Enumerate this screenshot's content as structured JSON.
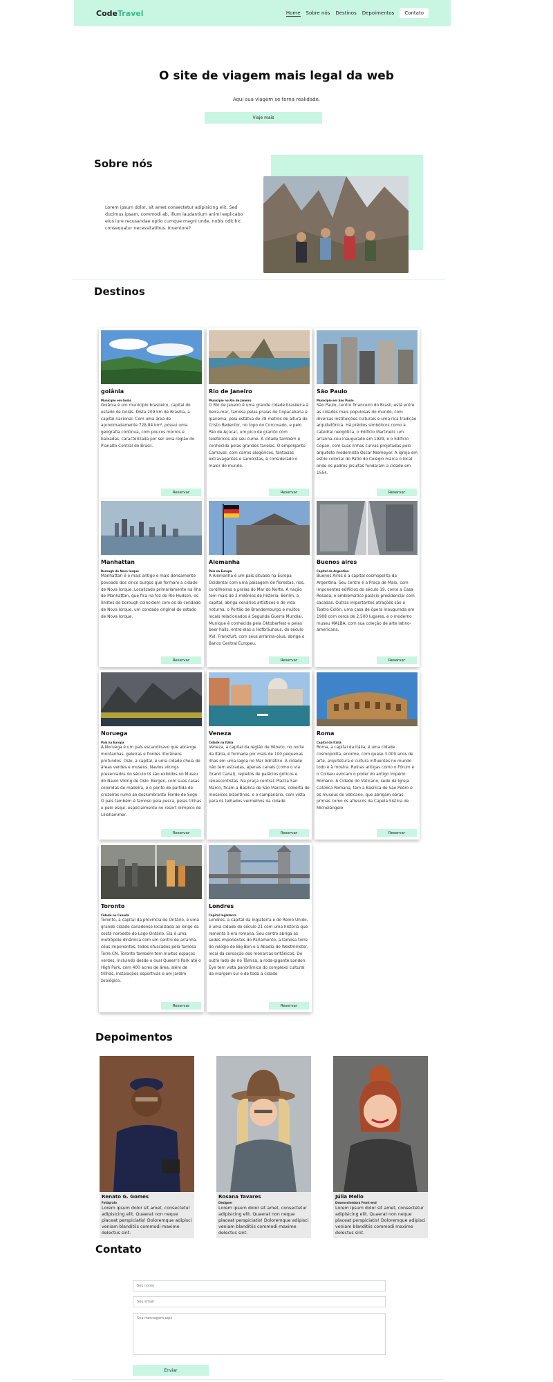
{
  "nav": {
    "logo_main": "Code",
    "logo_accent": "Travel",
    "links": [
      "Home",
      "Sobre nós",
      "Destinos",
      "Depoimentos"
    ],
    "cta": "Contato"
  },
  "hero": {
    "title": "O site de viagem mais legal da web",
    "subtitle": "Aqui sua viagem se torna realidade.",
    "button": "Viaje mais"
  },
  "about": {
    "title": "Sobre nós",
    "text": "Lorem ipsum dolor, sit amet consectetur adipisicing elit. Sed ducimus ipsam, commodi ab, illum laudantium animi explicabo eius iure recusandae optio cumque magni unde, nobis odit hic consequatur necessitatibus. Inventore?"
  },
  "destinations": {
    "title": "Destinos",
    "button_label": "Reservar",
    "cards": [
      {
        "title": "goiânia",
        "subtitle": "Município em Goiás",
        "text": "Goiânia é um município brasileiro, capital do estado de Goiás. Dista 209 km de Brasília, a capital nacional. Com uma área de aproximadamente 728,84 km², possui uma geografia contínua, com poucos morros e baixadas, caracterizada por ser uma região do Planalto Central do Brasil."
      },
      {
        "title": "Rio de Janeiro",
        "subtitle": "Município no Rio de Janeiro",
        "text": "O Rio de Janeiro é uma grande cidade brasileira à beira-mar, famosa pelas praias de Copacabana e Ipanema, pela estátua de 38 metros de altura do Cristo Redentor, no topo do Corcovado, e pelo Pão de Açúcar, um pico de granito com teleféricos até seu cume. A cidade também é conhecida pelas grandes favelas. O empolgante Carnaval, com carros alegóricos, fantasias extravagantes e sambistas, é considerado o maior do mundo."
      },
      {
        "title": "São Paulo",
        "subtitle": "Município em São Paulo",
        "text": "São Paulo, centro financeiro do Brasil, está entre as cidades mais populosas do mundo, com diversas instituições culturais e uma rica tradição arquitetônica. Há prédios simbólicos como a catedral neogótica, o Edifício Martinelli, um arranha-céu inaugurado em 1929, e o Edifício Copan, com suas linhas curvas projetadas pelo arquiteto modernista Oscar Niemeyer. A igreja em estilo colonial do Pátio do Colégio marca o local onde os padres jesuítas fundaram a cidade em 1554."
      },
      {
        "title": "Manhattan",
        "subtitle": "Borough de Nova Iorque",
        "text": "Manhattan é o mais antigo e mais densamente povoado dos cinco burgos que formam a cidade de Nova Iorque. Localizado primariamente na Ilha de Manhattan, que fica na foz do Rio Hudson, os limites do borough coincidem com os do condado de Nova Iorque, um condado original do estado de Nova Iorque."
      },
      {
        "title": "Alemanha",
        "subtitle": "País na Europa",
        "text": "A Alemanha é um país situado na Europa Ocidental com uma paisagem de florestas, rios, cordilheiras e praias do Mar do Norte. A nação tem mais de 2 milênios de história. Berlim, a capital, abriga cenários artísticos e de vida noturna, o Portão de Brandemburgo e muitos locais relacionados à Segunda Guerra Mundial. Munique é conhecida pela Oktoberfest e pelas beer halls, entre elas a Hofbräuhaus, do século XVI. Frankfurt, com seus arranha-céus, abriga o Banco Central Europeu."
      },
      {
        "title": "Buenos aires",
        "subtitle": "Capital da Argentina",
        "text": "Buenos Aires é a capital cosmopolita da Argentina. Seu centro é a Praça de Maio, com imponentes edifícios do século 19, como a Casa Rosada, o emblemático palácio presidencial com sacadas. Outras importantes atrações são o Teatro Colón, uma casa de ópera inaugurada em 1908 com cerca de 2.500 lugares, e o moderno museu MALBA, com sua coleção de arte latino-americana."
      },
      {
        "title": "Noruega",
        "subtitle": "País na Europa",
        "text": "A Noruega é um país escandinavo que abrange montanhas, geleiras e fiordes litorâneos profundos. Oslo, a capital, é uma cidade cheia de áreas verdes e museus. Navios vikings preservados do século IX são exibidos no Museu do Navio Viking de Oslo. Bergen, com suas casas coloridas de madeira, é o ponto de partida de cruzeiros rumo ao deslumbrante Fiorde de Sogn. O país também é famoso pela pesca, pelas trilhas e pelo esqui, especialmente no resort olímpico de Lillehammer."
      },
      {
        "title": "Veneza",
        "subtitle": "Cidade na Itália",
        "text": "Veneza, a capital da região de Vêneto, no norte da Itália, é formada por mais de 100 pequenas ilhas em uma lagoa no Mar Adriático. A cidade não tem estradas, apenas canais (como o via Grand Canal), repletos de palácios góticos e renascentistas. Na praça central, Piazza San Marco, ficam a Basílica de São Marcos, coberta de mosaicos bizantinos, e o campanário, com vista para os telhados vermelhos da cidade"
      },
      {
        "title": "Roma",
        "subtitle": "Capital da Itália",
        "text": "Roma, a capital da Itália, é uma cidade cosmopolita, enorme, com quase 3.000 anos de arte, arquitetura e cultura influentes no mundo todo e à mostra. Ruínas antigas como o Fórum e o Coliseu evocam o poder do antigo Império Romano. A Cidade do Vaticano, sede da Igreja Católica Romana, tem a Basílica de São Pedro e os museus do Vaticano, que abrigam obras-primas como os afrescos da Capela Sistina de Michelângelo"
      },
      {
        "title": "Toronto",
        "subtitle": "Cidade no Canadá",
        "text": "Toronto, a capital da província de Ontário, é uma grande cidade canadense localizada ao longo da costa noroeste do Lago Ontário. Ela é uma metrópole dinâmica com um centro de arranha-céus imponentes, todos ofuscados pela famosa Torre CN. Toronto também tem muitos espaços verdes, incluindo desde o oval Queen's Park até o High Park, com 400 acres de área, além de trilhas, instalações esportivas e um jardim zoológico."
      },
      {
        "title": "Londres",
        "subtitle": "Capital Inglaterra",
        "text": "Londres, a capital da Inglaterra e do Reino Unido, é uma cidade do século 21 com uma história que remonta à era romana. Seu centro abriga as sedes imponentes do Parlamento, a famosa torre do relógio do Big Ben e a Abadia de Westminster, local da coroação dos monarcas britânicos. Do outro lado do rio Tâmisa, a roda-gigante London Eye tem vista panorâmica do complexo cultural da margem sul e de toda a cidade"
      }
    ]
  },
  "testimonials": {
    "title": "Depoimentos",
    "items": [
      {
        "name": "Renato G. Gomes",
        "role": "Fotógrafo",
        "text": "Lorem ipsum dolor sit amet, consectetur adipisicing elit. Quaerat non neque placeat perspiciatis! Doloremque adipisci veniam blanditiis commodi maxime delectus sint."
      },
      {
        "name": "Rosana Tavares",
        "role": "Designer",
        "text": "Lorem ipsum dolor sit amet, consectetur adipisicing elit. Quaerat non neque placeat perspiciatis! Doloremque adipisci veniam blanditiis commodi maxime delectus sint."
      },
      {
        "name": "Júlia Mello",
        "role": "Desenvolvedora Front-end",
        "text": "Lorem ipsum dolor sit amet, consectetur adipisicing elit. Quaerat non neque placeat perspiciatis! Doloremque adipisci veniam blanditiis commodi maxime delectus sint."
      }
    ]
  },
  "contact": {
    "title": "Contato",
    "name_placeholder": "Seu nome",
    "email_placeholder": "Seu email",
    "message_placeholder": "Sua mensagem aqui",
    "submit": "Enviar"
  },
  "colors": {
    "accent": "#c9f5e3",
    "logo_accent": "#36c08f"
  }
}
